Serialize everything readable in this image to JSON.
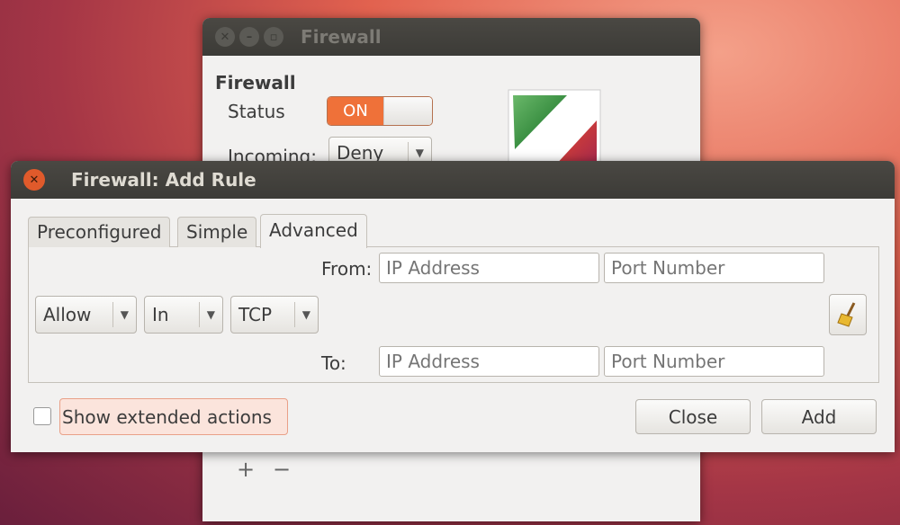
{
  "main_window": {
    "title": "Firewall",
    "heading": "Firewall",
    "status_label": "Status",
    "status_toggle": "ON",
    "incoming_label": "Incoming:",
    "incoming_value": "Deny",
    "add_symbol": "+",
    "remove_symbol": "−"
  },
  "dialog": {
    "title": "Firewall: Add Rule",
    "tabs": [
      {
        "label": "Preconfigured"
      },
      {
        "label": "Simple"
      },
      {
        "label": "Advanced",
        "active": true
      }
    ],
    "from_label": "From:",
    "to_label": "To:",
    "ip_placeholder": "IP Address",
    "port_placeholder": "Port Number",
    "action_value": "Allow",
    "direction_value": "In",
    "protocol_value": "TCP",
    "clear_icon": "broom-icon",
    "extended_label": "Show extended actions",
    "extended_checked": false,
    "close_label": "Close",
    "add_label": "Add"
  },
  "colors": {
    "accent": "#ef7139",
    "titlebar": "#3c3b37"
  }
}
